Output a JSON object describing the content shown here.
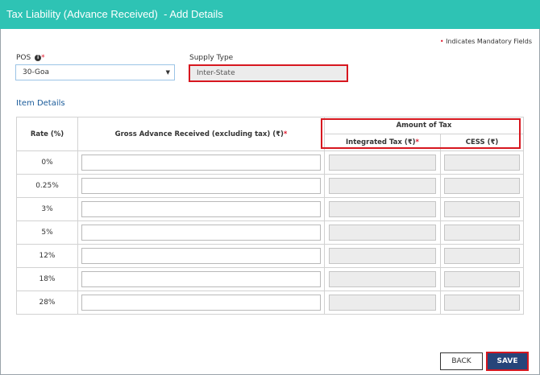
{
  "header": {
    "title": "Tax Liability (Advance Received)  - Add Details"
  },
  "mandatory_note": {
    "star": "•",
    "text": "Indicates Mandatory Fields"
  },
  "pos": {
    "label": "POS",
    "info": "i",
    "required": "*",
    "value": "30-Goa",
    "chevron": "▼"
  },
  "supply_type": {
    "label": "Supply Type",
    "value": "Inter-State"
  },
  "section": {
    "title": "Item Details"
  },
  "table": {
    "headers": {
      "rate": "Rate (%)",
      "gross": "Gross Advance Received (excluding tax) (₹)",
      "gross_required": "*",
      "amount_of_tax": "Amount of Tax",
      "integrated": "Integrated Tax (₹)",
      "integrated_required": "*",
      "cess": "CESS (₹)"
    },
    "rows": [
      {
        "rate": "0%"
      },
      {
        "rate": "0.25%"
      },
      {
        "rate": "3%"
      },
      {
        "rate": "5%"
      },
      {
        "rate": "12%"
      },
      {
        "rate": "18%"
      },
      {
        "rate": "28%"
      }
    ]
  },
  "buttons": {
    "back": "BACK",
    "save": "SAVE"
  },
  "colors": {
    "header_bg": "#2ec3b4",
    "highlight": "#d7171f",
    "save_bg": "#27457a",
    "link": "#1a5b9a"
  }
}
